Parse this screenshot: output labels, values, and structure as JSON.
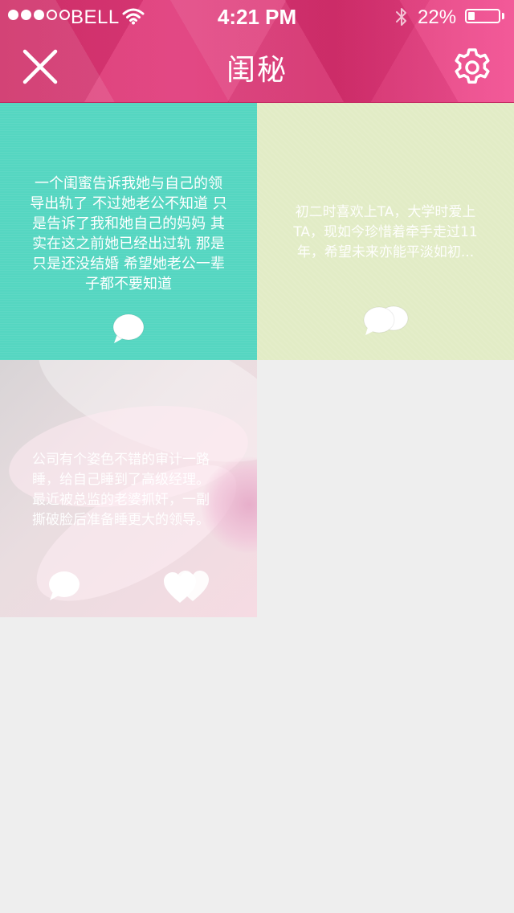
{
  "status_bar": {
    "carrier": "BELL",
    "time": "4:21 PM",
    "battery_percent": "22%",
    "battery_level": 0.22,
    "signal_bars_filled": 3,
    "signal_bars_total": 5
  },
  "header": {
    "title": "闺秘",
    "close_icon": "close-icon",
    "settings_icon": "gear-icon",
    "accent_color": "#e0397a"
  },
  "cards": [
    {
      "lines": [
        "一个闺蜜告诉我她与自己的领",
        "导出轨了 不过她老公不知道 只",
        "是告诉了我和她自己的妈妈 其",
        "实在这之前她已经出过轨 那是",
        "只是还没结婚 希望她老公一辈",
        "子都不要知道"
      ],
      "background_color": "#55d6c1",
      "icons": [
        "comment-icon"
      ]
    },
    {
      "lines": [
        "初二时喜欢上TA，大学时爱上",
        "TA，现如今珍惜着牵手走过11",
        "年，希望未来亦能平淡如初..."
      ],
      "background_color": "#e2ecc6",
      "icons": [
        "comments-icon"
      ]
    },
    {
      "lines": [
        "公司有个姿色不错的审计一路",
        "睡，给自己睡到了高级经理。",
        "最近被总监的老婆抓奸，一副",
        "撕破脸后准备睡更大的领导。"
      ],
      "background_color": "#f6dbe3",
      "icons": [
        "comment-icon",
        "hearts-icon"
      ]
    }
  ]
}
